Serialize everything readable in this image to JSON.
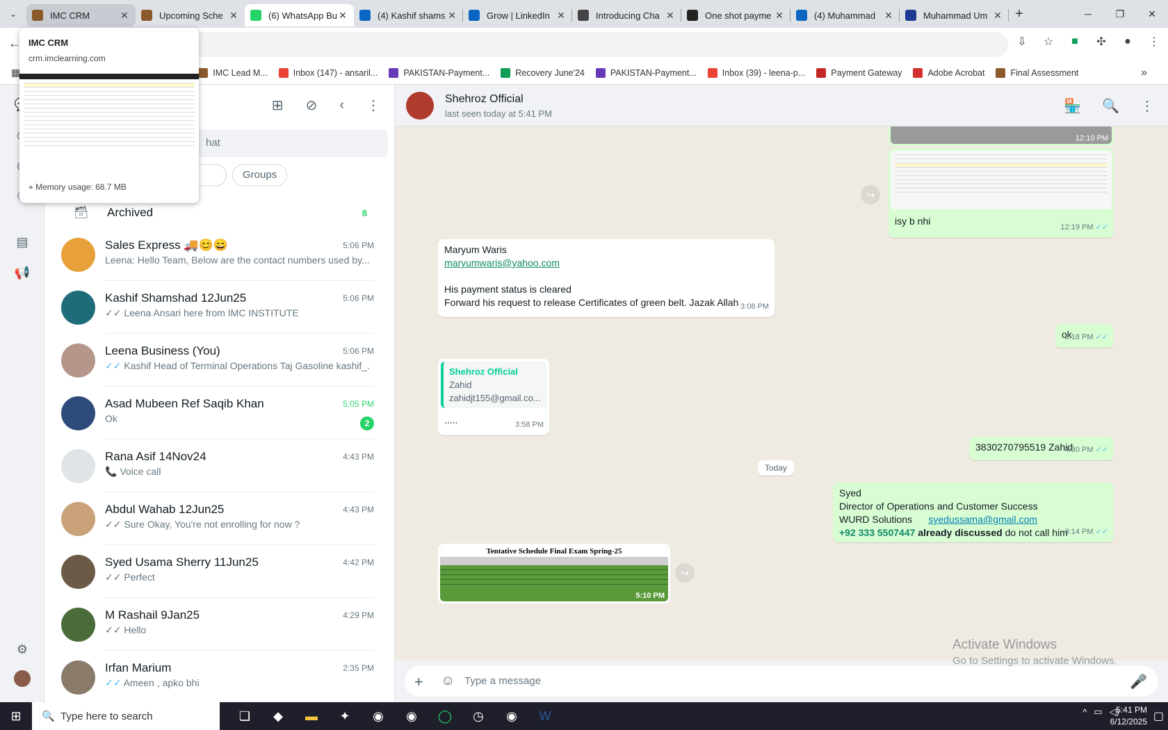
{
  "tabs": [
    {
      "title": "IMC CRM",
      "color": "#8a5a2b"
    },
    {
      "title": "Upcoming Sche",
      "color": "#8a5a2b"
    },
    {
      "title": "(6) WhatsApp Bu",
      "color": "#25d366"
    },
    {
      "title": "(4) Kashif shams",
      "color": "#0a66c2"
    },
    {
      "title": "Grow | LinkedIn",
      "color": "#0a66c2"
    },
    {
      "title": "Introducing Cha",
      "color": "#444444"
    },
    {
      "title": "One shot payme",
      "color": "#222222"
    },
    {
      "title": "(4) Muhammad",
      "color": "#0a66c2"
    },
    {
      "title": "Muhammad Um",
      "color": "#1f3a93"
    }
  ],
  "new_tab": "+",
  "bookmarks": [
    {
      "label": "IMC Lead M...",
      "color": "#8a5a2b"
    },
    {
      "label": "Inbox (147) - ansaril...",
      "color": "#ea4335"
    },
    {
      "label": "PAKISTAN-Payment...",
      "color": "#673ab7"
    },
    {
      "label": "Recovery June'24",
      "color": "#0f9d58"
    },
    {
      "label": "PAKISTAN-Payment...",
      "color": "#673ab7"
    },
    {
      "label": "Inbox (39) - leena-p...",
      "color": "#ea4335"
    },
    {
      "label": "Payment Gateway",
      "color": "#c62828"
    },
    {
      "label": "Adobe Acrobat",
      "color": "#d32f2f"
    },
    {
      "label": "Final Assessment",
      "color": "#8a5a2b"
    }
  ],
  "popup": {
    "title": "IMC CRM",
    "url": "crm.imclearning.com",
    "memory": "Memory usage: 68.7 MB"
  },
  "sidebar": {
    "search_placeholder": "hat",
    "filters": [
      "",
      "Groups"
    ],
    "archived_label": "Archived",
    "archived_count": "8",
    "chats": [
      {
        "name": "Sales Express 🚚😊😄",
        "preview": "Leena: Hello Team, Below are the contact numbers used by...",
        "time": "5:06 PM",
        "tick": "",
        "avatar_color": "#e8a13a"
      },
      {
        "name": "Kashif Shamshad 12Jun25",
        "preview": "Leena Ansari here from IMC INSTITUTE",
        "time": "5:06 PM",
        "tick": "✓✓",
        "avatar_color": "#1e6b7a"
      },
      {
        "name": "Leena Business (You)",
        "preview": "Kashif Head of Terminal Operations Taj Gasoline kashif_...",
        "time": "5:06 PM",
        "tick": "✓✓",
        "avatar_color": "#b5968a"
      },
      {
        "name": "Asad Mubeen Ref Saqib Khan",
        "preview": "Ok",
        "time": "5:05 PM",
        "tick": "",
        "unread": "2",
        "avatar_color": "#2e4a7a"
      },
      {
        "name": "Rana Asif 14Nov24",
        "preview": "Voice call",
        "time": "4:43 PM",
        "tick": "📞",
        "avatar_color": "#dfe5e7"
      },
      {
        "name": "Abdul Wahab 12Jun25",
        "preview": "Sure Okay,  You're not enrolling for now ?",
        "time": "4:43 PM",
        "tick": "✓✓",
        "avatar_color": "#c9a27a"
      },
      {
        "name": "Syed Usama Sherry 11Jun25",
        "preview": "Perfect",
        "time": "4:42 PM",
        "tick": "✓✓",
        "avatar_color": "#6b5a45"
      },
      {
        "name": "M Rashail 9Jan25",
        "preview": "Hello",
        "time": "4:29 PM",
        "tick": "✓✓",
        "avatar_color": "#4a6b3a"
      },
      {
        "name": "Irfan Marium",
        "preview": "Ameen , apko bhi",
        "time": "2:35 PM",
        "tick": "✓✓",
        "avatar_color": "#8a7a6a"
      }
    ]
  },
  "conversation": {
    "name": "Shehroz Official",
    "status": "last seen today at 5:41 PM",
    "composer_placeholder": "Type a message",
    "date_chip": "Today",
    "messages": {
      "img1_time": "12:10 PM",
      "isy_text": "isy b nhi",
      "isy_time": "12:19 PM",
      "maryum_line1": "Maryum Waris",
      "maryum_email": "maryumwaris@yahoo.com",
      "maryum_line3": "His payment status is cleared",
      "maryum_line4": "Forward his request to release Certificates of green belt. Jazak Allah",
      "maryum_time": "3:08 PM",
      "ok_text": "ok",
      "ok_time": "3:18 PM",
      "quote_name": "Shehroz Official",
      "quote_l1": "Zahid",
      "quote_l2": "zahidjt155@gmail.co...",
      "quote_reply": ".....",
      "quote_time": "3:58 PM",
      "cnic_text": "3830270795519 Zahid",
      "cnic_time": "4:30 PM",
      "syed_l1": "Syed",
      "syed_l2": "Director of Operations and Customer Success",
      "syed_l3": "WURD Solutions",
      "syed_email": "syedussama@gmail.com",
      "syed_phone": "+92 333 5507447",
      "syed_bold": "already discussed",
      "syed_rest": "do not call him",
      "syed_time": "3:14 PM",
      "img_title": "Tentative Schedule Final Exam Spring-25",
      "img_time": "5:10 PM"
    }
  },
  "watermark": {
    "line1": "Activate Windows",
    "line2": "Go to Settings to activate Windows."
  },
  "taskbar": {
    "search_placeholder": "Type here to search",
    "time": "5:41 PM",
    "date": "6/12/2025"
  }
}
